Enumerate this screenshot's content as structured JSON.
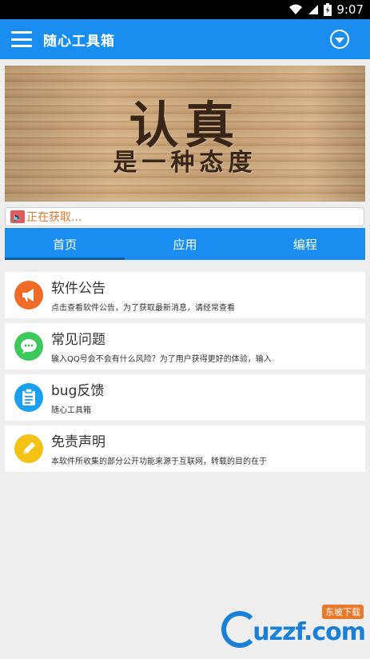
{
  "status_bar": {
    "time": "9:07",
    "icons": [
      "wifi-icon",
      "signal-icon",
      "battery-icon"
    ]
  },
  "app_bar": {
    "title": "随心工具箱",
    "menu_icon": "menu-icon",
    "action_icon": "dropdown-circle-icon"
  },
  "banner": {
    "title": "认真",
    "subtitle": "是一种态度"
  },
  "notice": {
    "icon": "speaker-icon",
    "text": "正在获取..."
  },
  "tabs": [
    {
      "label": "首页",
      "active": true
    },
    {
      "label": "应用",
      "active": false
    },
    {
      "label": "编程",
      "active": false
    }
  ],
  "list": [
    {
      "title": "软件公告",
      "desc": "点击查看软件公告，为了获取最新消息，请经常查看",
      "icon": "megaphone-icon",
      "color": "#f06a28"
    },
    {
      "title": "常见问题",
      "desc": "输入QQ号会不会有什么风险？为了用户获得更好的体验，输入",
      "icon": "chat-icon",
      "color": "#3cc85a"
    },
    {
      "title": "bug反馈",
      "desc": "随心工具箱",
      "icon": "clipboard-icon",
      "color": "#1aa0ee"
    },
    {
      "title": "免责声明",
      "desc": "本软件所收集的部分公开功能来源于互联网，转载的目的在于",
      "icon": "pencil-icon",
      "color": "#f4c215"
    }
  ],
  "watermark": {
    "text": "uzzf.com",
    "badge": "东坡下载"
  },
  "colors": {
    "primary": "#1a8ef0",
    "notice_text": "#e8782a"
  }
}
